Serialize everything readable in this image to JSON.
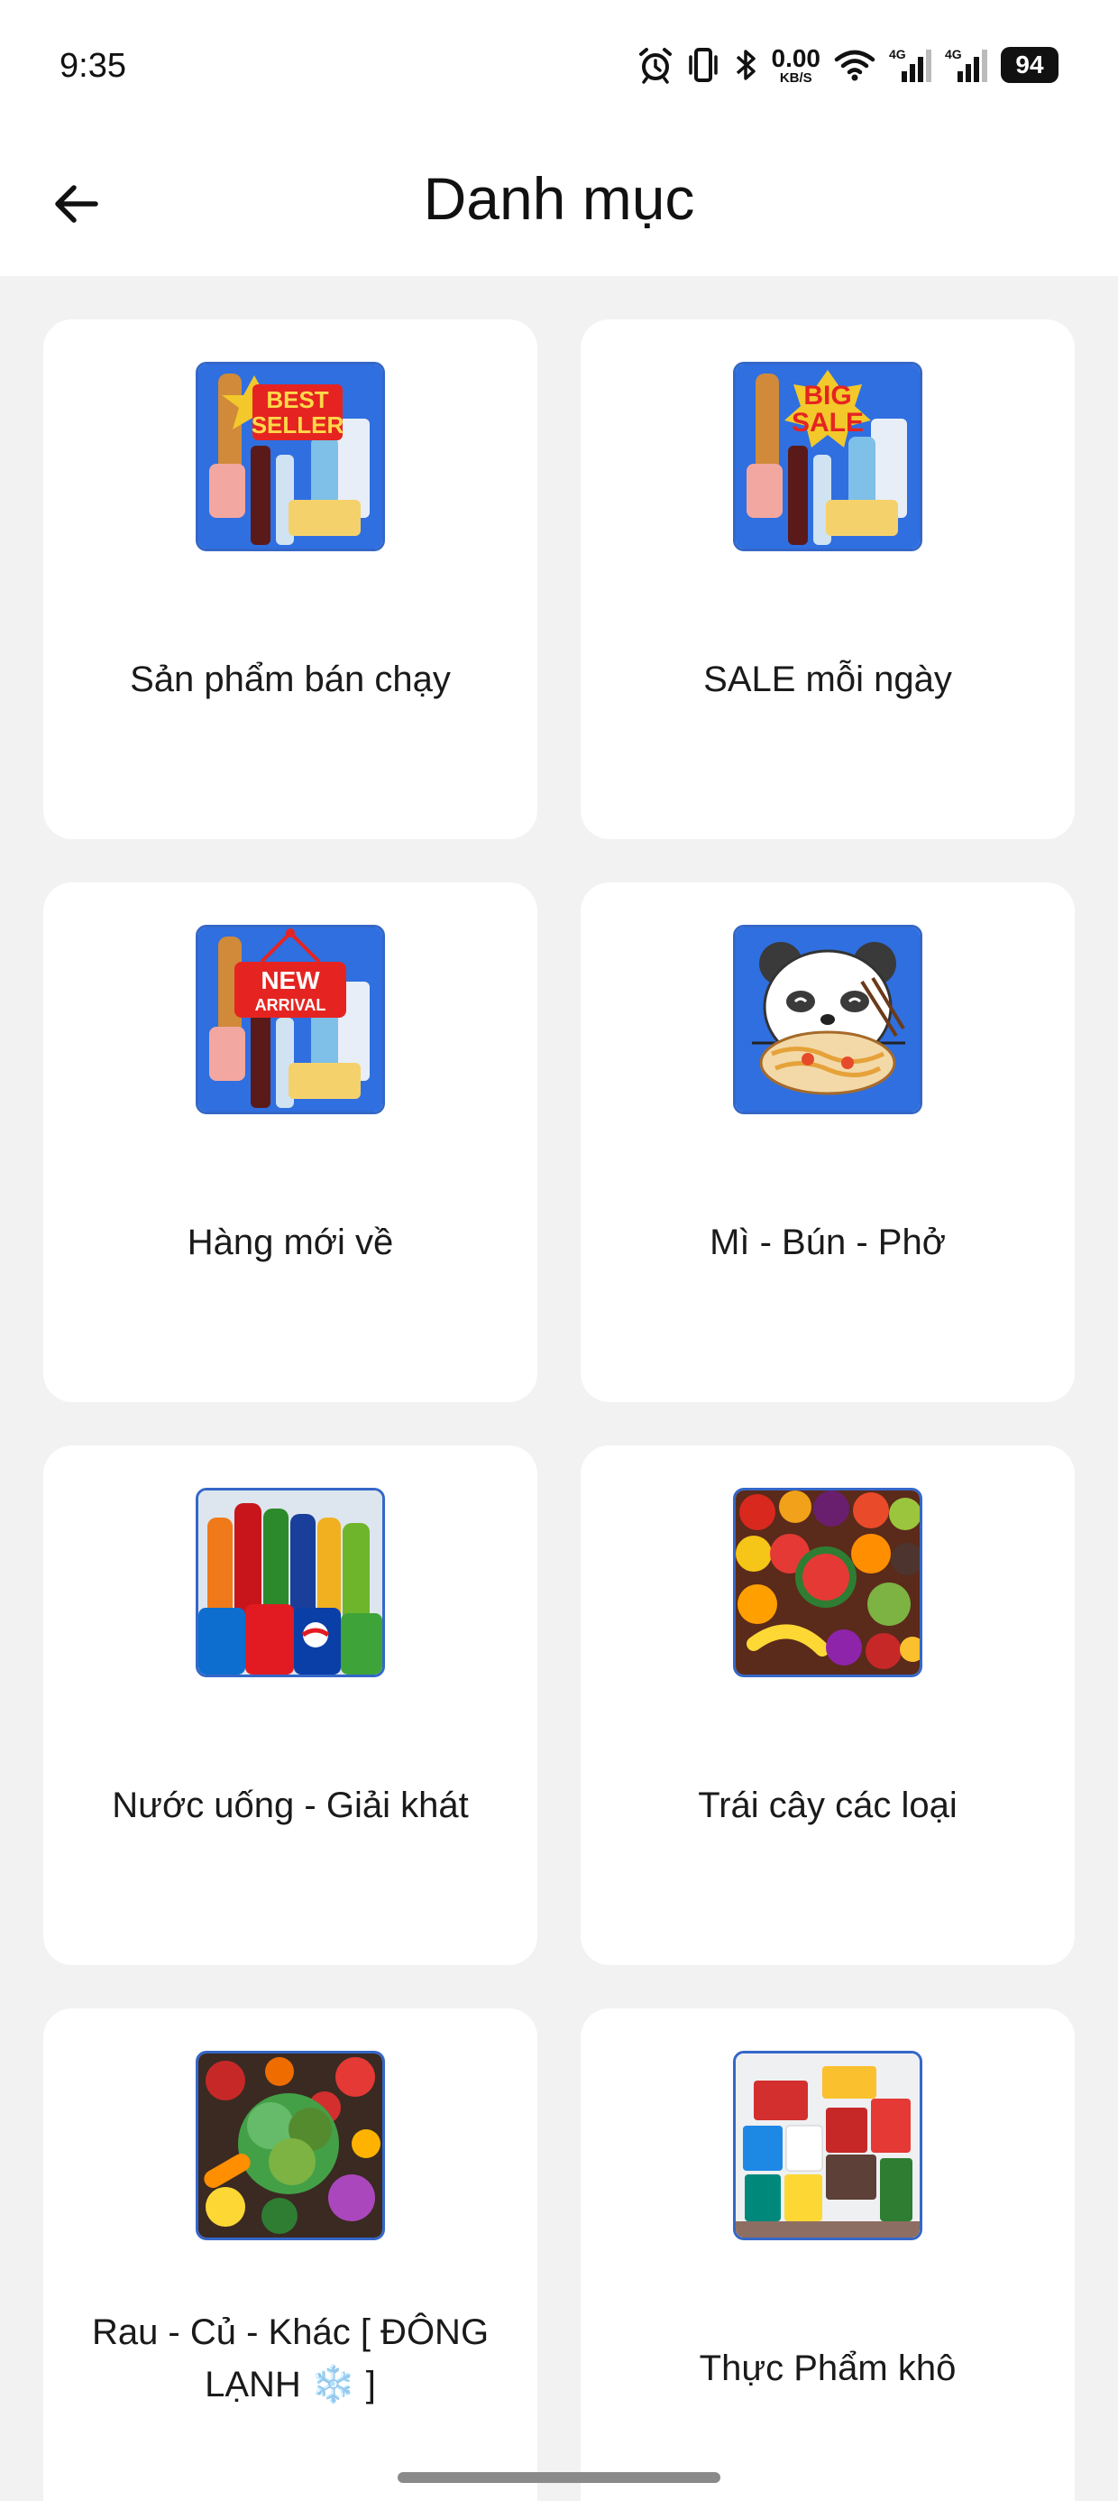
{
  "status_bar": {
    "time": "9:35",
    "net_speed_value": "0.00",
    "net_speed_unit": "KB/S",
    "signal_1_label": "4G",
    "signal_2_label": "4G",
    "battery": "94"
  },
  "header": {
    "title": "Danh mục",
    "back_icon": "arrow-left-icon"
  },
  "categories": [
    {
      "label": "Sản phẩm bán chạy",
      "thumb": "best-seller"
    },
    {
      "label": "SALE mỗi ngày",
      "thumb": "big-sale"
    },
    {
      "label": "Hàng mới về",
      "thumb": "new-arrival"
    },
    {
      "label": "Mì - Bún - Phở",
      "thumb": "panda-noodles"
    },
    {
      "label": "Nước uống - Giải khát",
      "thumb": "soft-drinks"
    },
    {
      "label": "Trái cây các loại",
      "thumb": "fruits"
    },
    {
      "label": "Rau - Củ - Khác [ ĐÔNG LẠNH ❄️ ]",
      "thumb": "vegetables"
    },
    {
      "label": "Thực Phẩm khô",
      "thumb": "dry-food"
    }
  ],
  "thumb_text": {
    "best_seller_line1": "BEST",
    "best_seller_line2": "SELLER",
    "big_sale_line1": "BIG",
    "big_sale_line2": "SALE",
    "new_arrival_line1": "NEW",
    "new_arrival_line2": "ARRIVAL"
  },
  "colors": {
    "thumb_border": "#3467c8",
    "thumb_bg": "#2f6fe0",
    "badge_red": "#e52421"
  }
}
